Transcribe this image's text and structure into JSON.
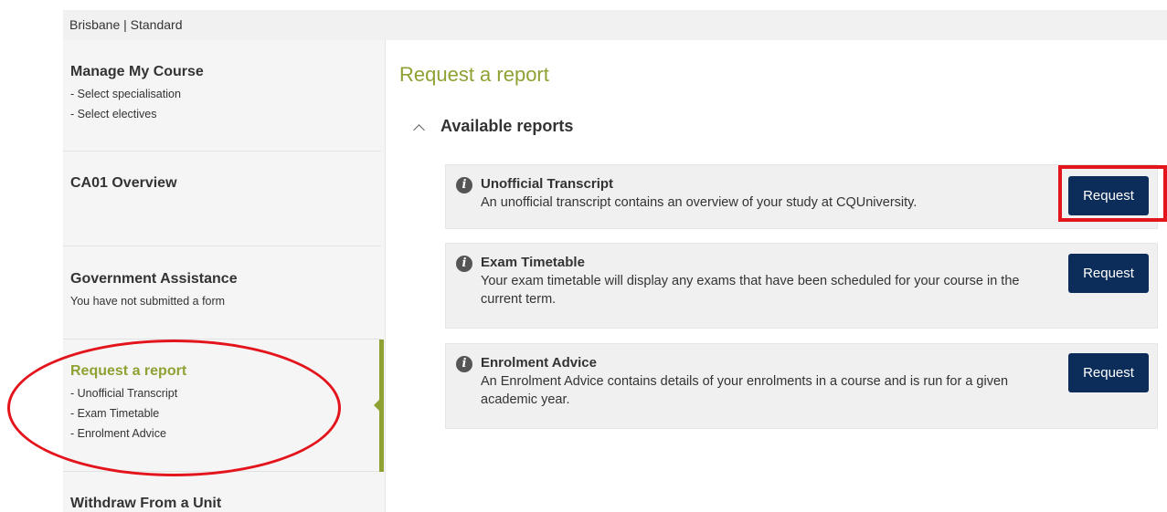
{
  "location": {
    "text": "Brisbane | Standard"
  },
  "sidebar": {
    "sections": [
      {
        "title": "Manage My Course",
        "items": [
          "- Select specialisation",
          "- Select electives"
        ]
      },
      {
        "title": "CA01 Overview",
        "items": []
      },
      {
        "title": "Government Assistance",
        "items": [
          "You have not submitted a form"
        ]
      },
      {
        "title": "Request a report",
        "items": [
          "- Unofficial Transcript",
          "- Exam Timetable",
          "- Enrolment Advice"
        ],
        "active": true
      },
      {
        "title": "Withdraw From a Unit",
        "items": []
      }
    ]
  },
  "main": {
    "title": "Request a report",
    "section_label": "Available reports",
    "reports": [
      {
        "title": "Unofficial Transcript",
        "description": "An unofficial transcript contains an overview of your study at CQUniversity.",
        "button_label": "Request"
      },
      {
        "title": "Exam Timetable",
        "description": "Your exam timetable will display any exams that have been scheduled for your course in the current term.",
        "button_label": "Request"
      },
      {
        "title": "Enrolment Advice",
        "description": "An Enrolment Advice contains details of your enrolments in a course and is run for a given academic year.",
        "button_label": "Request"
      }
    ]
  },
  "icons": {
    "info": "info-icon",
    "collapse": "chevron-up-icon"
  },
  "colors": {
    "accent_green": "#8ea234",
    "button_navy": "#0c2d5a",
    "annotation_red": "#e3141b",
    "card_background": "#f0f0f0",
    "sidebar_background": "#f5f5f5"
  }
}
